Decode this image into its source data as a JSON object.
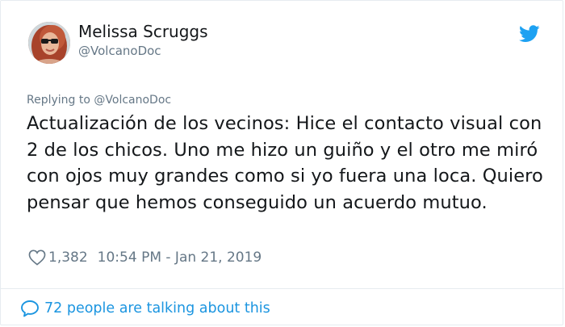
{
  "author": {
    "name": "Melissa Scruggs",
    "handle": "@VolcanoDoc",
    "avatar_icon": "profile-photo"
  },
  "reply_context": {
    "prefix": "Replying to",
    "handle": "@VolcanoDoc"
  },
  "tweet": {
    "text": "Actualización de los vecinos: Hice el contacto visual con 2 de los chicos. Uno me hizo un guiño y el otro me miró con ojos muy grandes como si yo fuera una loca. Quiero pensar que hemos conseguido un acuerdo mutuo."
  },
  "meta": {
    "like_count": "1,382",
    "timestamp": "10:54 PM - Jan 21, 2019"
  },
  "footer": {
    "talking_text": "72 people are talking about this"
  },
  "colors": {
    "twitter_blue": "#1da1f2",
    "link_blue": "#1b95e0",
    "secondary_text": "#657786",
    "primary_text": "#14171a"
  }
}
